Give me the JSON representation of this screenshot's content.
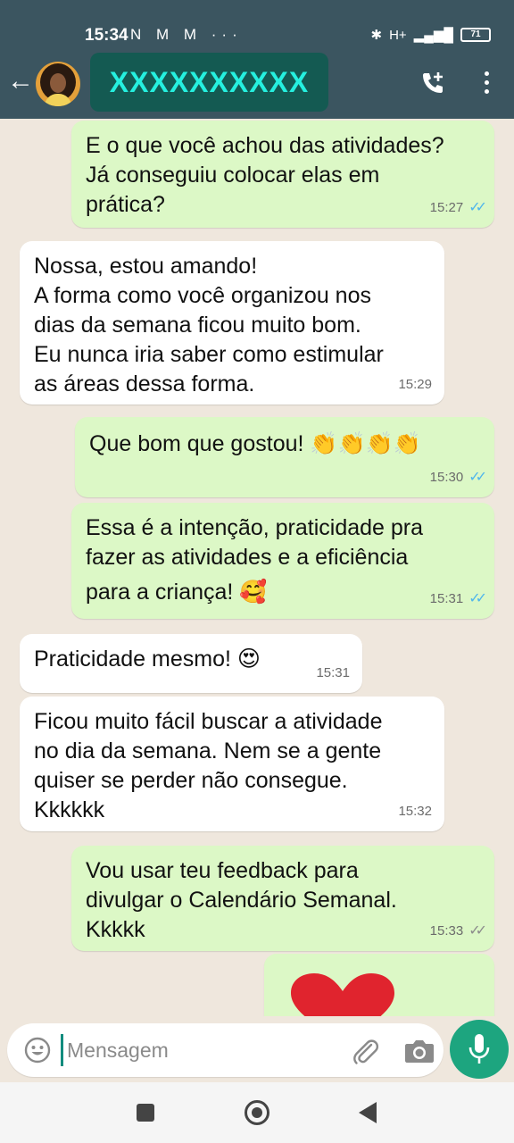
{
  "status_bar": {
    "time": "15:34",
    "notifications": "N M M ···",
    "network": "H+",
    "battery": "71"
  },
  "header": {
    "contact_name": "XXXXXXXXXX",
    "back_icon": "arrow-left-icon",
    "call_icon": "add-call-icon",
    "menu_icon": "more-vert-icon"
  },
  "messages": [
    {
      "direction": "out",
      "lines": [
        "E o que você achou das atividades?",
        "Já conseguiu colocar elas em",
        "prática?"
      ],
      "time": "15:27",
      "read": true
    },
    {
      "direction": "in",
      "lines": [
        "Nossa, estou amando!",
        "A forma como você organizou nos",
        "dias da semana ficou muito bom.",
        "Eu nunca iria saber como estimular",
        "as áreas dessa forma."
      ],
      "time": "15:29"
    },
    {
      "direction": "out",
      "lines": [
        "Que bom que gostou! 👏👏👏👏"
      ],
      "time": "15:30",
      "read": true
    },
    {
      "direction": "out",
      "lines": [
        "Essa é a intenção, praticidade pra",
        "fazer as atividades e a eficiência",
        "para a criança! 🥰"
      ],
      "time": "15:31",
      "read": true
    },
    {
      "direction": "in",
      "lines": [
        "Praticidade mesmo! 😍"
      ],
      "time": "15:31"
    },
    {
      "direction": "in",
      "lines": [
        "Ficou muito fácil buscar a atividade",
        "no dia da semana. Nem se a gente",
        "quiser se perder não consegue.",
        "Kkkkkk"
      ],
      "time": "15:32"
    },
    {
      "direction": "out",
      "lines": [
        "Vou usar teu feedback para",
        "divulgar o Calendário Semanal.",
        "Kkkkk"
      ],
      "time": "15:33",
      "read": false
    },
    {
      "direction": "out",
      "lines": [
        "❤️"
      ],
      "time": ""
    }
  ],
  "input": {
    "placeholder": "Mensagem",
    "emoji_icon": "emoji-icon",
    "attach_icon": "paperclip-icon",
    "camera_icon": "camera-icon",
    "mic_icon": "mic-icon"
  },
  "colors": {
    "header_bg": "#3b5560",
    "chat_bg": "#efe7dd",
    "outgoing_bubble": "#dcf8c6",
    "incoming_bubble": "#ffffff",
    "read_ticks": "#4fb6ec",
    "mic_button": "#1da57f"
  }
}
